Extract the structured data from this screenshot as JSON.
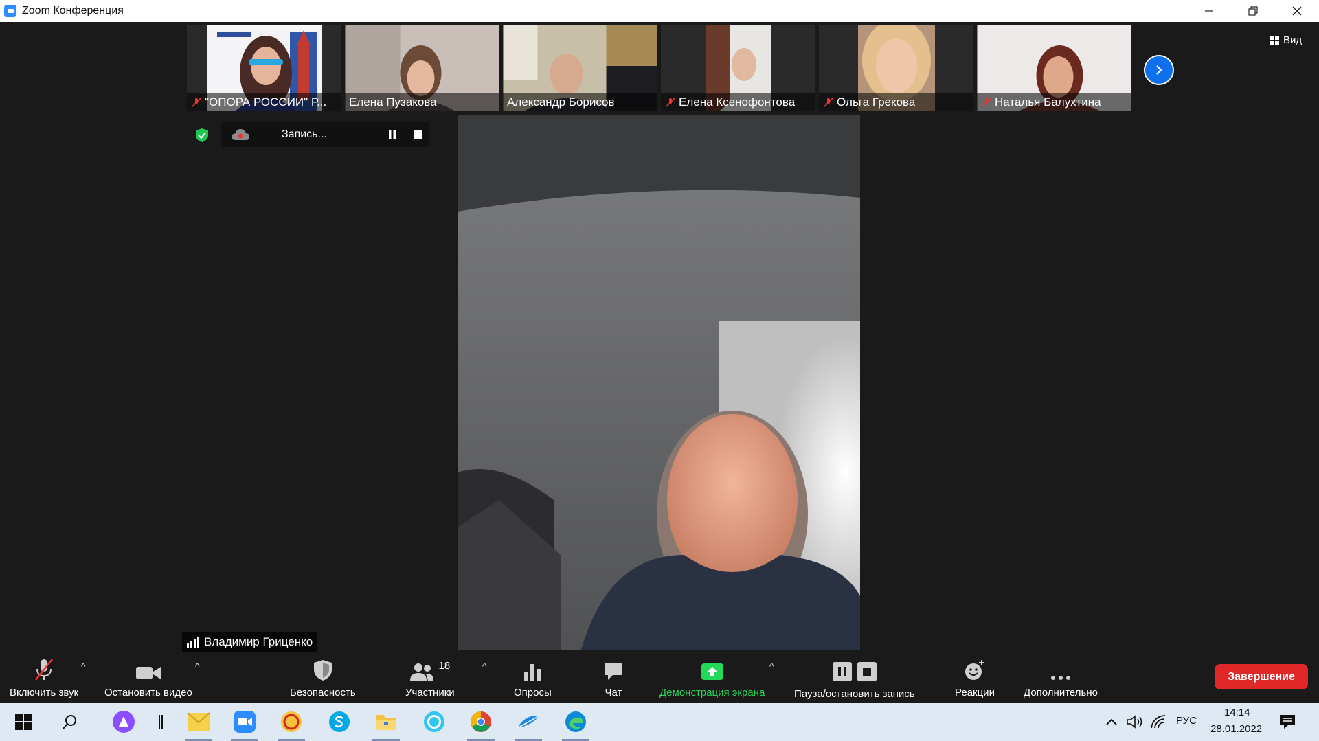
{
  "window": {
    "title": "Zoom Конференция"
  },
  "participants": [
    {
      "name": "\"ОПОРА РОССИИ\" Р...",
      "muted": true
    },
    {
      "name": "Елена Пузакова",
      "muted": false
    },
    {
      "name": "Александр Борисов",
      "muted": false
    },
    {
      "name": "Елена Ксенофонтова",
      "muted": true
    },
    {
      "name": "Ольга Грекова",
      "muted": true
    },
    {
      "name": "Наталья Балухтина",
      "muted": true
    }
  ],
  "view": {
    "label": "Вид"
  },
  "recording": {
    "status": "Запись..."
  },
  "active_speaker": {
    "name": "Владимир Гриценко"
  },
  "toolbar": {
    "unmute": "Включить звук",
    "stop_video": "Остановить видео",
    "security": "Безопасность",
    "participants": "Участники",
    "participants_count": "18",
    "polls": "Опросы",
    "chat": "Чат",
    "share_screen": "Демонстрация экрана",
    "pause_stop_recording": "Пауза/остановить запись",
    "reactions": "Реакции",
    "more": "Дополнительно",
    "end": "Завершение"
  },
  "colors": {
    "share_green": "#23d959",
    "end_red": "#e02828",
    "accent_blue": "#0e71eb"
  },
  "taskbar": {
    "language": "РУС",
    "time": "14:14",
    "date": "28.01.2022"
  }
}
